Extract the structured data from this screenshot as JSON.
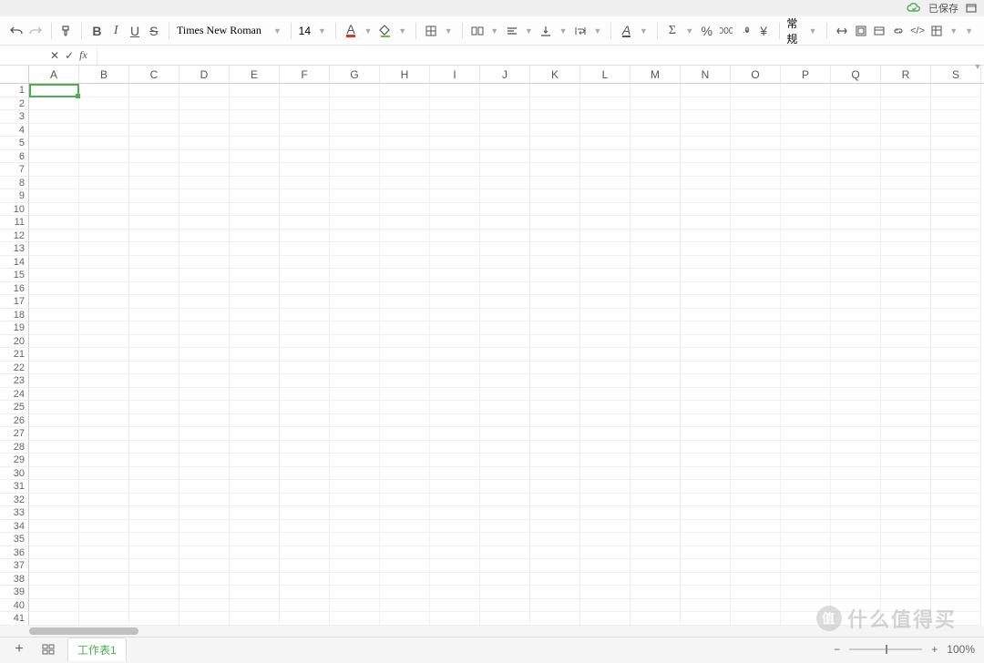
{
  "topbar": {
    "save_status": "已保存"
  },
  "toolbar": {
    "font_name": "Times New Roman",
    "font_size": "14",
    "number_format": "常规"
  },
  "formula_bar": {
    "fx_label": "fx"
  },
  "grid": {
    "columns": [
      "A",
      "B",
      "C",
      "D",
      "E",
      "F",
      "G",
      "H",
      "I",
      "J",
      "K",
      "L",
      "M",
      "N",
      "O",
      "P",
      "Q",
      "R",
      "S"
    ],
    "row_count": 43,
    "active_cell": "A1"
  },
  "bottombar": {
    "sheet_tab": "工作表1",
    "zoom": "100%"
  },
  "watermark": {
    "brand": "什么值得买",
    "badge": "值"
  }
}
